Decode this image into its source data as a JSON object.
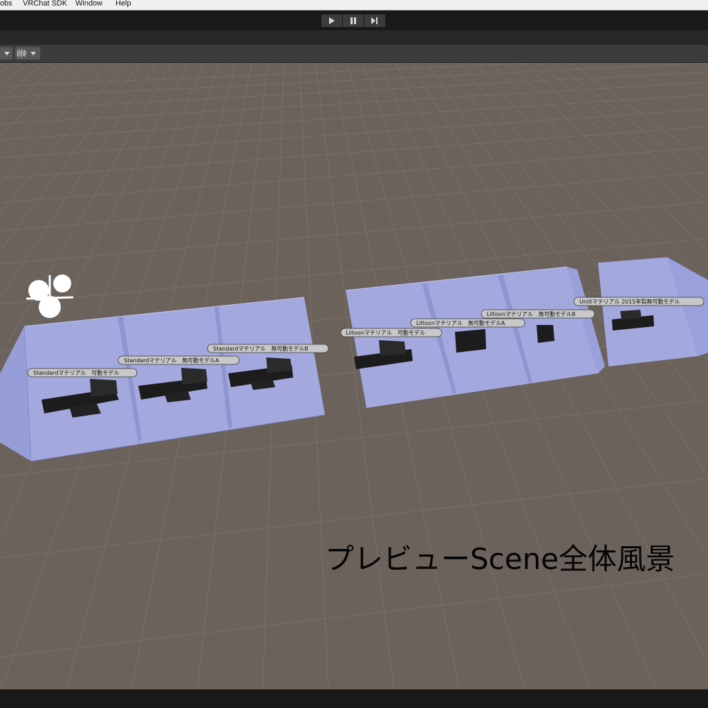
{
  "menu": {
    "items": [
      "obs",
      "VRChat SDK",
      "Window",
      "Help"
    ]
  },
  "toolbar": {
    "play_icon": "play-icon",
    "pause_icon": "pause-icon",
    "step_icon": "step-icon"
  },
  "scene": {
    "labels": [
      "Standardマテリアル　可動モデル",
      "Standardマテリアル　無可動モデルA",
      "Standardマテリアル　無可動モデルB",
      "Liltoonマテリアル　可動モデル",
      "Liltoonマテリアル　無可動モデルA",
      "Liltoonマテリアル　無可動モデルB",
      "Unlitマテリアル 2015年製無可動モデル"
    ],
    "caption": "プレビューScene全体風景"
  },
  "colors": {
    "ground": "#6b625c",
    "grid_line": "#80776f",
    "glass": "#a8aee8",
    "glass_dark": "#8e94d0",
    "chrome_dark": "#191919",
    "panel": "#3c3c3c"
  }
}
